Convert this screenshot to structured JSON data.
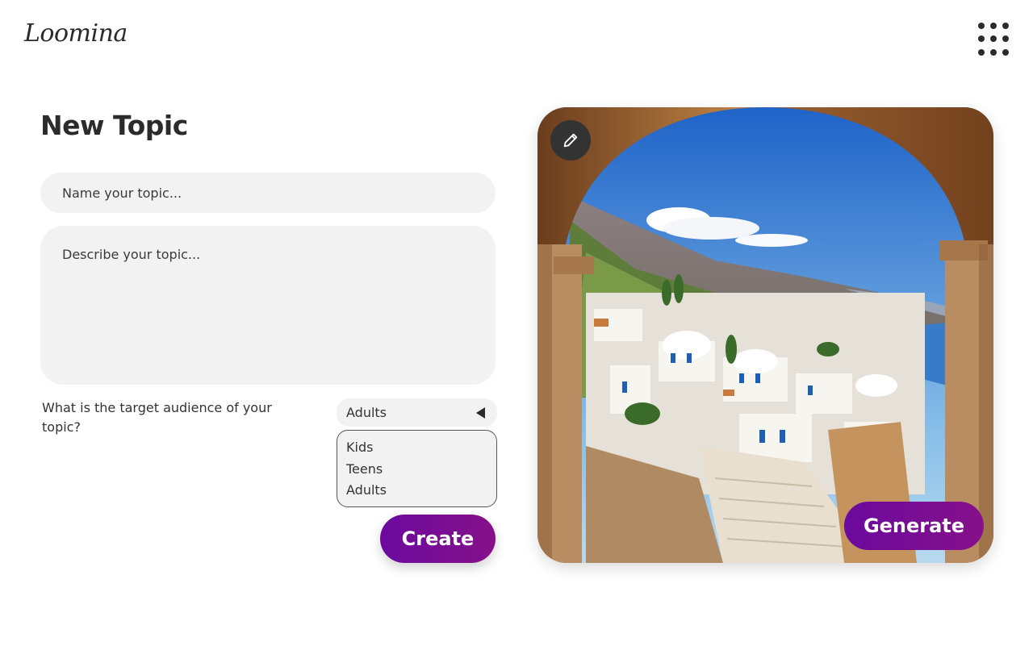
{
  "header": {
    "logo_text": "Loomina",
    "apps_icon": "grid-dots-icon"
  },
  "form": {
    "title": "New Topic",
    "name_placeholder": "Name your topic...",
    "description_placeholder": "Describe your topic...",
    "audience_question": "What is the target audience of your topic?",
    "audience_selected": "Adults",
    "audience_options": [
      "Kids",
      "Teens",
      "Adults"
    ],
    "create_label": "Create"
  },
  "image_panel": {
    "edit_icon": "pencil-icon",
    "generate_label": "Generate"
  },
  "colors": {
    "accent": "#7a0e96",
    "input_bg": "#f2f2f2",
    "text": "#2b2b2b"
  }
}
